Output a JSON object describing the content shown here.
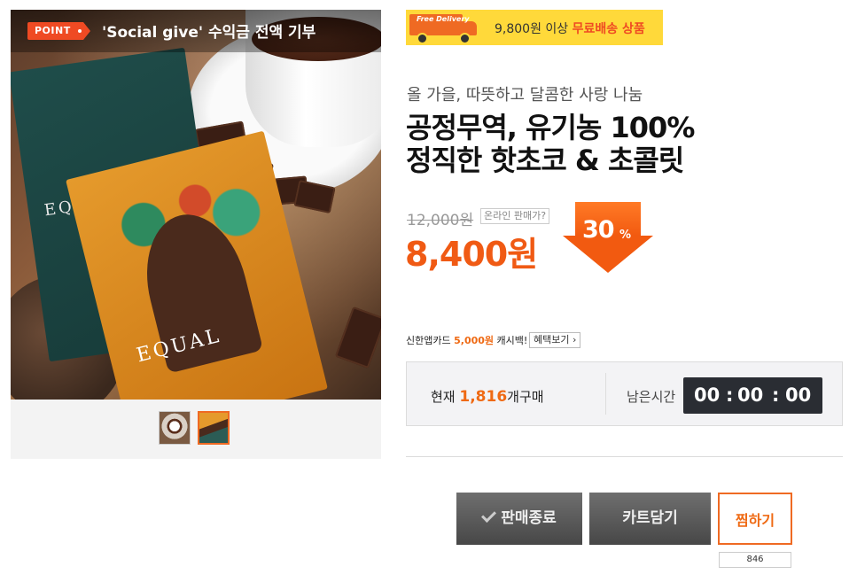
{
  "gallery": {
    "point_tag": "POINT",
    "point_text": "'Social give' 수익금 전액 기부",
    "pack_brand": "EQUAL"
  },
  "shipping": {
    "badge_text": "Free Delivery",
    "threshold": "9,800원 이상",
    "highlight": "무료배송 상품"
  },
  "product": {
    "subtitle": "올 가을, 따뜻하고 달콤한 사랑 나눔",
    "title_line1": "공정무역, 유기농 100%",
    "title_line2": "정직한 핫초코 & 초콜릿"
  },
  "price": {
    "original": "12,000원",
    "online_price_label": "온라인 판매가?",
    "sale": "8,400원",
    "discount_value": "30",
    "discount_unit": "%"
  },
  "card_promo": {
    "text_prefix": "신한앱카드",
    "amount": "5,000원",
    "text_suffix": "캐시백!",
    "button_label": "혜택보기"
  },
  "status": {
    "current_label": "현재",
    "count": "1,816",
    "count_suffix": "개구매",
    "remaining_label": "남은시간",
    "hours": "00",
    "minutes": "00",
    "seconds": "00"
  },
  "actions": {
    "soldout_label": "판매종료",
    "cart_label": "카트담기",
    "wish_label": "찜하기",
    "wish_count": "846"
  },
  "colors": {
    "accent": "#ef6a14",
    "banner_yellow": "#ffd93a",
    "dark_button": "#474747"
  }
}
